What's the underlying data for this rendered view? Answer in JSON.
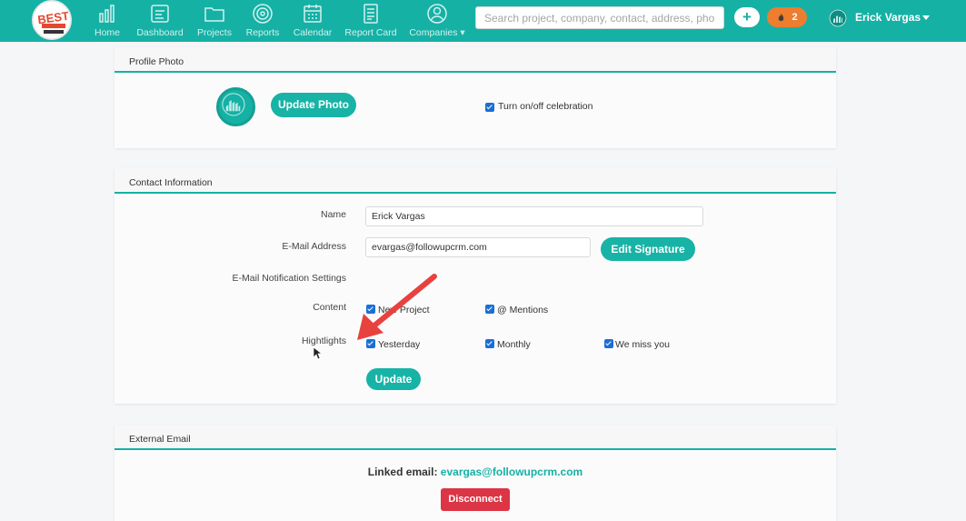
{
  "nav": {
    "logo_text": "BEST",
    "items": [
      {
        "label": "Home",
        "icon": "home-icon"
      },
      {
        "label": "Dashboard",
        "icon": "dashboard-icon"
      },
      {
        "label": "Projects",
        "icon": "folder-icon"
      },
      {
        "label": "Reports",
        "icon": "target-icon"
      },
      {
        "label": "Calendar",
        "icon": "calendar-icon"
      },
      {
        "label": "Report Card",
        "icon": "report-card-icon"
      },
      {
        "label": "Companies",
        "icon": "user-circle-icon"
      }
    ],
    "search_placeholder": "Search project, company, contact, address, phone",
    "plus_label": "+",
    "notification_count": "2",
    "user_name": "Erick Vargas"
  },
  "profile_photo": {
    "title": "Profile Photo",
    "update_button": "Update Photo",
    "celebration_label": "Turn on/off celebration",
    "celebration_checked": true
  },
  "contact_info": {
    "title": "Contact Information",
    "name_label": "Name",
    "name_value": "Erick Vargas",
    "email_label": "E-Mail Address",
    "email_value": "evargas@followupcrm.com",
    "edit_signature_button": "Edit Signature",
    "notification_settings_label": "E-Mail Notification Settings",
    "content_label": "Content",
    "content_options": [
      {
        "label": "New Project",
        "checked": true
      },
      {
        "label": "@ Mentions",
        "checked": true
      }
    ],
    "highlights_label": "Hightlights",
    "highlight_options": [
      {
        "label": "Yesterday",
        "checked": true
      },
      {
        "label": "Monthly",
        "checked": true
      },
      {
        "label": "We miss you",
        "checked": true
      }
    ],
    "update_button": "Update"
  },
  "external_email": {
    "title": "External Email",
    "linked_label": "Linked email:",
    "linked_email": "evargas@followupcrm.com",
    "disconnect_button": "Disconnect"
  },
  "colors": {
    "brand_teal": "#16b1a5",
    "danger_red": "#dc3545",
    "notification_orange": "#ed7d2f",
    "annotation_arrow": "#e8423f"
  }
}
